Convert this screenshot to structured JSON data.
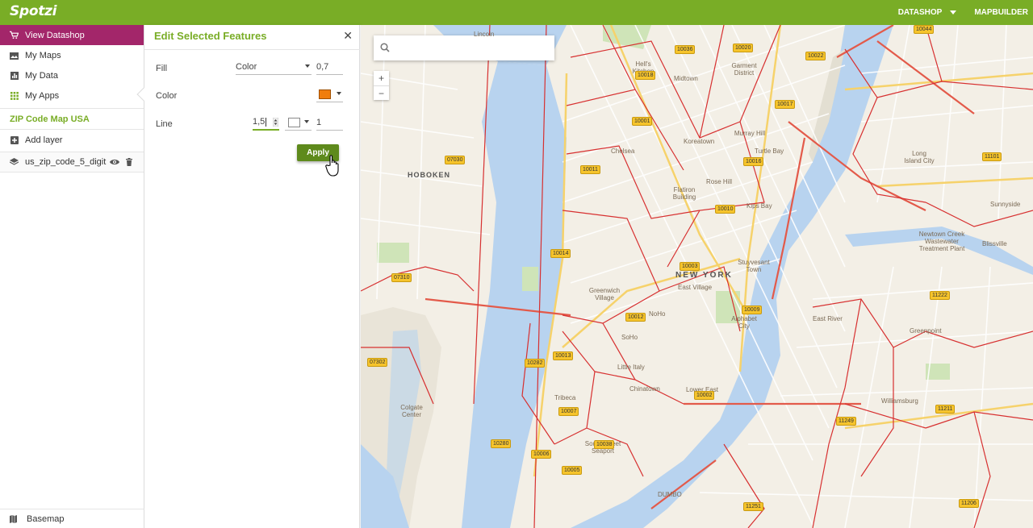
{
  "app": {
    "logo": "Spotzi"
  },
  "topnav": {
    "datashop": "DATASHOP",
    "mapbuilder": "MAPBUILDER"
  },
  "sidebar": {
    "items": [
      {
        "label": "View Datashop",
        "icon": "cart-icon"
      },
      {
        "label": "My Maps",
        "icon": "image-icon"
      },
      {
        "label": "My Data",
        "icon": "chart-icon"
      },
      {
        "label": "My Apps",
        "icon": "grid-icon"
      }
    ],
    "project_title": "ZIP Code Map USA",
    "add_layer": "Add layer",
    "layer_name": "us_zip_code_5_digit",
    "basemap": "Basemap"
  },
  "edit_panel": {
    "title": "Edit Selected Features",
    "fill_label": "Fill",
    "fill_type": "Color",
    "fill_opacity": "0,7",
    "color_label": "Color",
    "color_value": "#f07d0c",
    "line_label": "Line",
    "line_width": "1,5",
    "line_color": "#ffffff",
    "line_opacity": "1",
    "apply_label": "Apply"
  },
  "map": {
    "zoom_in": "+",
    "zoom_out": "−",
    "places": [
      {
        "text": "Lincoln"
      },
      {
        "text": "HOBOKEN"
      },
      {
        "text": "NEW YORK"
      },
      {
        "text": "Hell's Kitchen"
      },
      {
        "text": "Midtown"
      },
      {
        "text": "Garment District"
      },
      {
        "text": "Chelsea"
      },
      {
        "text": "Koreatown"
      },
      {
        "text": "Murray Hill"
      },
      {
        "text": "Turtle Bay"
      },
      {
        "text": "Flatiron Building"
      },
      {
        "text": "Rose Hill"
      },
      {
        "text": "Kips Bay"
      },
      {
        "text": "Greenwich Village"
      },
      {
        "text": "NoHo"
      },
      {
        "text": "SoHo"
      },
      {
        "text": "East Village"
      },
      {
        "text": "Stuyvesant Town"
      },
      {
        "text": "Alphabet City"
      },
      {
        "text": "Tribeca"
      },
      {
        "text": "Little Italy"
      },
      {
        "text": "Chinatown"
      },
      {
        "text": "Lower East Side"
      },
      {
        "text": "DUMBO"
      },
      {
        "text": "Long Island City"
      },
      {
        "text": "Sunnyside"
      },
      {
        "text": "Greenpoint"
      },
      {
        "text": "Williamsburg"
      },
      {
        "text": "Colgate Center"
      },
      {
        "text": "South Street Seaport"
      },
      {
        "text": "Newtown Creek Wastewater Treatment Plant"
      },
      {
        "text": "Blissville"
      },
      {
        "text": "East River"
      }
    ],
    "zips": [
      "10036",
      "10020",
      "10044",
      "10022",
      "10018",
      "10017",
      "10001",
      "10016",
      "07030",
      "10011",
      "10010",
      "10003",
      "10014",
      "07310",
      "10012",
      "10009",
      "10282",
      "10013",
      "07302",
      "10007",
      "10002",
      "10038",
      "10280",
      "10006",
      "10005",
      "11101",
      "11222",
      "11249",
      "11211",
      "11251",
      "11206"
    ]
  },
  "colors": {
    "brand": "#79ad26",
    "active": "#a3266a",
    "water": "#b8d3ef",
    "zip_line": "#d73030"
  }
}
